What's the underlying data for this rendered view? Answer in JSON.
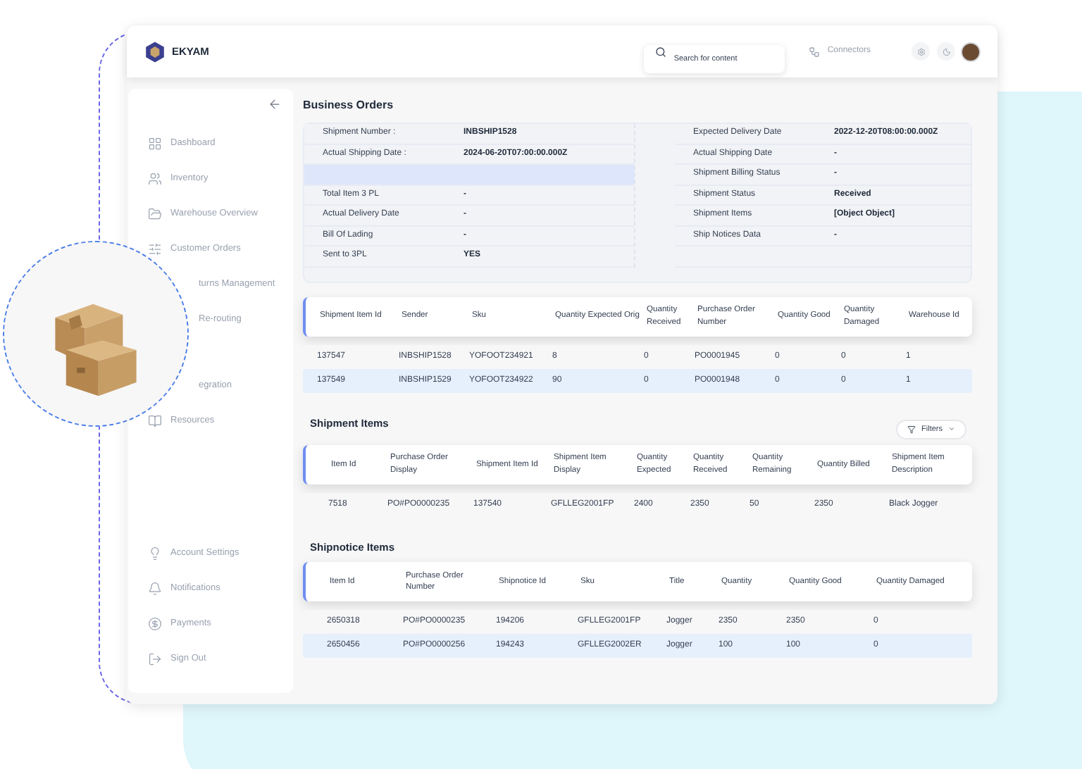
{
  "header": {
    "brand": "EKYAM",
    "search": {
      "placeholder": "Search for content"
    },
    "connectors": "Connectors"
  },
  "sidebar": {
    "items": [
      {
        "label": "Dashboard",
        "kind": "full"
      },
      {
        "label": "Inventory",
        "kind": "full"
      },
      {
        "label": "Warehouse Overview",
        "kind": "full"
      },
      {
        "label": "Customer Orders",
        "kind": "full"
      },
      {
        "label": "turns Management",
        "kind": "partial"
      },
      {
        "label": "Re-routing",
        "kind": "partial"
      },
      {
        "label": "egration",
        "kind": "partial"
      },
      {
        "label": "Resources",
        "kind": "full"
      }
    ],
    "bottom_items": [
      {
        "label": "Account Settings"
      },
      {
        "label": "Notifications"
      },
      {
        "label": "Payments"
      },
      {
        "label": "Sign Out"
      }
    ]
  },
  "business_orders": {
    "title": "Business Orders",
    "left": [
      {
        "kind": "field",
        "label": "Shipment Number :",
        "value": "INBSHIP1528",
        "highlighted": false
      },
      {
        "kind": "field",
        "label": "Actual Shipping Date :",
        "value": "2024-06-20T07:00:00.000Z",
        "highlighted": false
      },
      {
        "kind": "blank",
        "highlighted": true
      },
      {
        "kind": "field",
        "label": "Total Item 3 PL",
        "value": "-",
        "highlighted": false
      },
      {
        "kind": "field",
        "label": "Actual Delivery Date",
        "value": "-",
        "highlighted": false
      },
      {
        "kind": "field",
        "label": "Bill Of Lading",
        "value": "-",
        "highlighted": false
      },
      {
        "kind": "field",
        "label": "Sent  to 3PL",
        "value": "YES",
        "highlighted": false
      }
    ],
    "right": [
      {
        "kind": "field",
        "label": "Expected Delivery Date",
        "value": "2022-12-20T08:00:00.000Z",
        "highlighted": false
      },
      {
        "kind": "field",
        "label": "Actual Shipping Date",
        "value": "-",
        "highlighted": false
      },
      {
        "kind": "field",
        "label": "Shipment Billing Status",
        "value": "-",
        "highlighted": false
      },
      {
        "kind": "field",
        "label": "Shipment Status",
        "value": "Received",
        "highlighted": false
      },
      {
        "kind": "field",
        "label": "Shipment Items",
        "value": "[Object Object]",
        "highlighted": false
      },
      {
        "kind": "field",
        "label": "Ship Notices Data",
        "value": "-",
        "highlighted": false
      },
      {
        "kind": "blank",
        "highlighted": false
      }
    ]
  },
  "tables": [
    {
      "columns": [
        "Shipment Item Id",
        "Sender",
        "Sku",
        "Quantity Expected Orig",
        "Quantity Received",
        "Purchase Order Number",
        "Quantity Good",
        "Quantity Damaged",
        "Warehouse Id"
      ],
      "rows": [
        {
          "cells": [
            "137547",
            "INBSHIP1528",
            "YOFOOT234921",
            "8",
            "0",
            "PO0001945",
            "0",
            "0",
            "1"
          ],
          "highlighted": false
        },
        {
          "cells": [
            "137549",
            "INBSHIP1529",
            "YOFOOT234922",
            "90",
            "0",
            "PO0001948",
            "0",
            "0",
            "1"
          ],
          "highlighted": true
        }
      ]
    },
    {
      "title": "Shipment Items",
      "filters": "Filters",
      "columns": [
        "Item Id",
        "Purchase Order Display",
        "Shipment Item Id",
        "Shipment Item Display",
        "Quantity Expected",
        "Quantity Received",
        "Quantity Remaining",
        "Quantity Billed",
        "Shipment Item Description"
      ],
      "rows": [
        {
          "cells": [
            "7518",
            "PO#PO0000235",
            "137540",
            "GFLLEG2001FP",
            "2400",
            "2350",
            "50",
            "2350",
            "Black Jogger"
          ],
          "highlighted": false
        }
      ]
    },
    {
      "title": "Shipnotice Items",
      "columns": [
        "Item Id",
        "Purchase Order Number",
        "Shipnotice Id",
        "Sku",
        "Title",
        "Quantity",
        "Quantity Good",
        "Quantity Damaged"
      ],
      "rows": [
        {
          "cells": [
            "2650318",
            "PO#PO0000235",
            "194206",
            "GFLLEG2001FP",
            "Jogger",
            "2350",
            "2350",
            "0"
          ],
          "highlighted": false
        },
        {
          "cells": [
            "2650456",
            "PO#PO0000256",
            "194243",
            "GFLLEG2002ER",
            "Jogger",
            "100",
            "100",
            "0"
          ],
          "highlighted": true
        }
      ]
    }
  ]
}
